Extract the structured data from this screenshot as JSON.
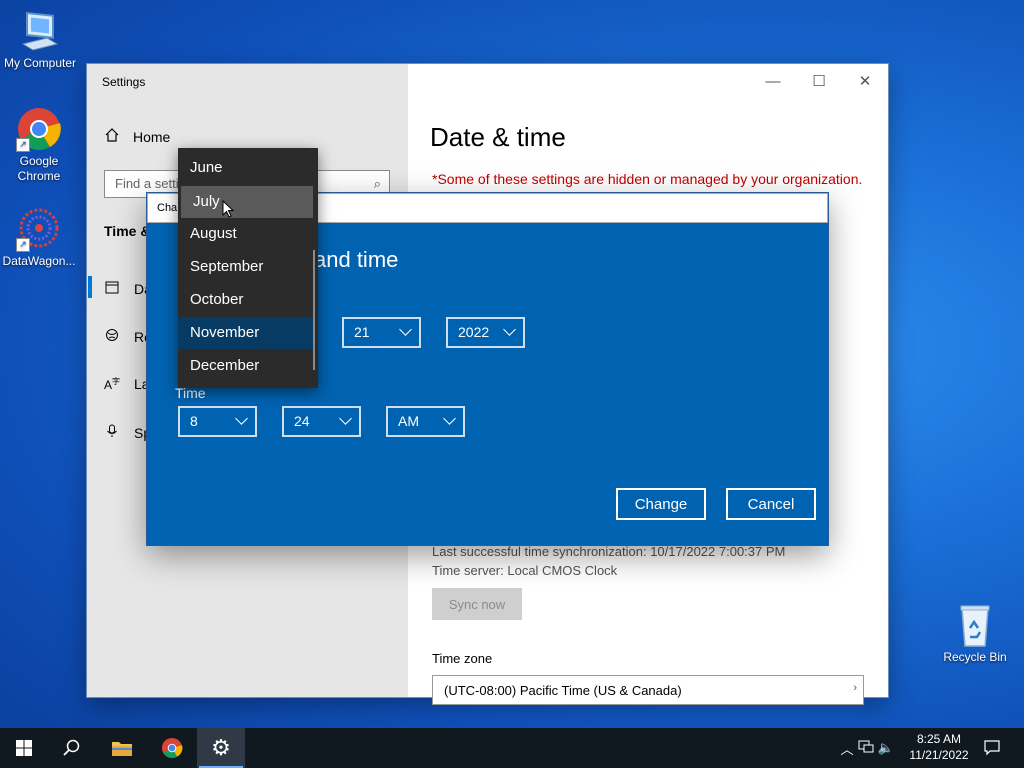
{
  "desktop": {
    "icons": [
      {
        "label": "My Computer"
      },
      {
        "label": "Google Chrome"
      },
      {
        "label": "DataWagon..."
      },
      {
        "label": "Recycle Bin"
      }
    ]
  },
  "settings": {
    "window_title": "Settings",
    "home_label": "Home",
    "find_placeholder": "Find a setti",
    "section_heading": "Time &",
    "nav_items": [
      {
        "label": "Da",
        "icon": "date-time-icon"
      },
      {
        "label": "Re",
        "icon": "region-icon"
      },
      {
        "label": "La",
        "icon": "language-icon"
      },
      {
        "label": "Sp",
        "icon": "speech-icon"
      }
    ],
    "page_title": "Date & time",
    "managed_notice": "*Some of these settings are hidden or managed by your organization.",
    "last_sync": "Last successful time synchronization: 10/17/2022 7:00:37 PM",
    "time_server": "Time server: Local CMOS Clock",
    "sync_button": "Sync now",
    "time_zone_label": "Time zone",
    "time_zone_value": "(UTC-08:00) Pacific Time (US & Canada)"
  },
  "dialog": {
    "title": "Cha",
    "heading": "and time",
    "day": "21",
    "year": "2022",
    "time_label": "Time",
    "hour": "8",
    "minute": "24",
    "ampm": "AM",
    "change_button": "Change",
    "cancel_button": "Cancel",
    "month_options": [
      "June",
      "July",
      "August",
      "September",
      "October",
      "November",
      "December"
    ],
    "hovered_month": "July",
    "selected_month": "November"
  },
  "taskbar": {
    "time": "8:25 AM",
    "date": "11/21/2022"
  },
  "colors": {
    "dialog_blue": "#0063b1",
    "warning_red": "#c00000",
    "accent": "#0078d7"
  }
}
